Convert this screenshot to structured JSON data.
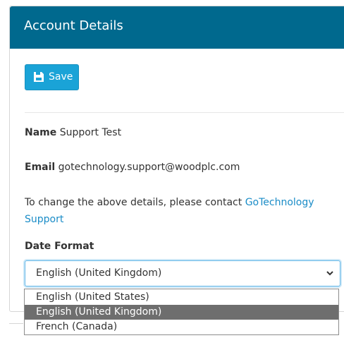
{
  "panel": {
    "title": "Account Details"
  },
  "toolbar": {
    "save_label": "Save",
    "save_icon": "save-icon"
  },
  "details": {
    "name_label": "Name",
    "name_value": "Support Test",
    "email_label": "Email",
    "email_value": "gotechnology.support@woodplc.com"
  },
  "note": {
    "text": "To change the above details, please contact ",
    "link": "GoTechnology Support"
  },
  "date_format": {
    "label": "Date Format",
    "selected": "English (United Kingdom)",
    "options": [
      "English (United States)",
      "English (United Kingdom)",
      "French (Canada)"
    ]
  },
  "colors": {
    "header": "#00698e",
    "accent": "#1aa3d7",
    "link": "#1a8cc7"
  }
}
